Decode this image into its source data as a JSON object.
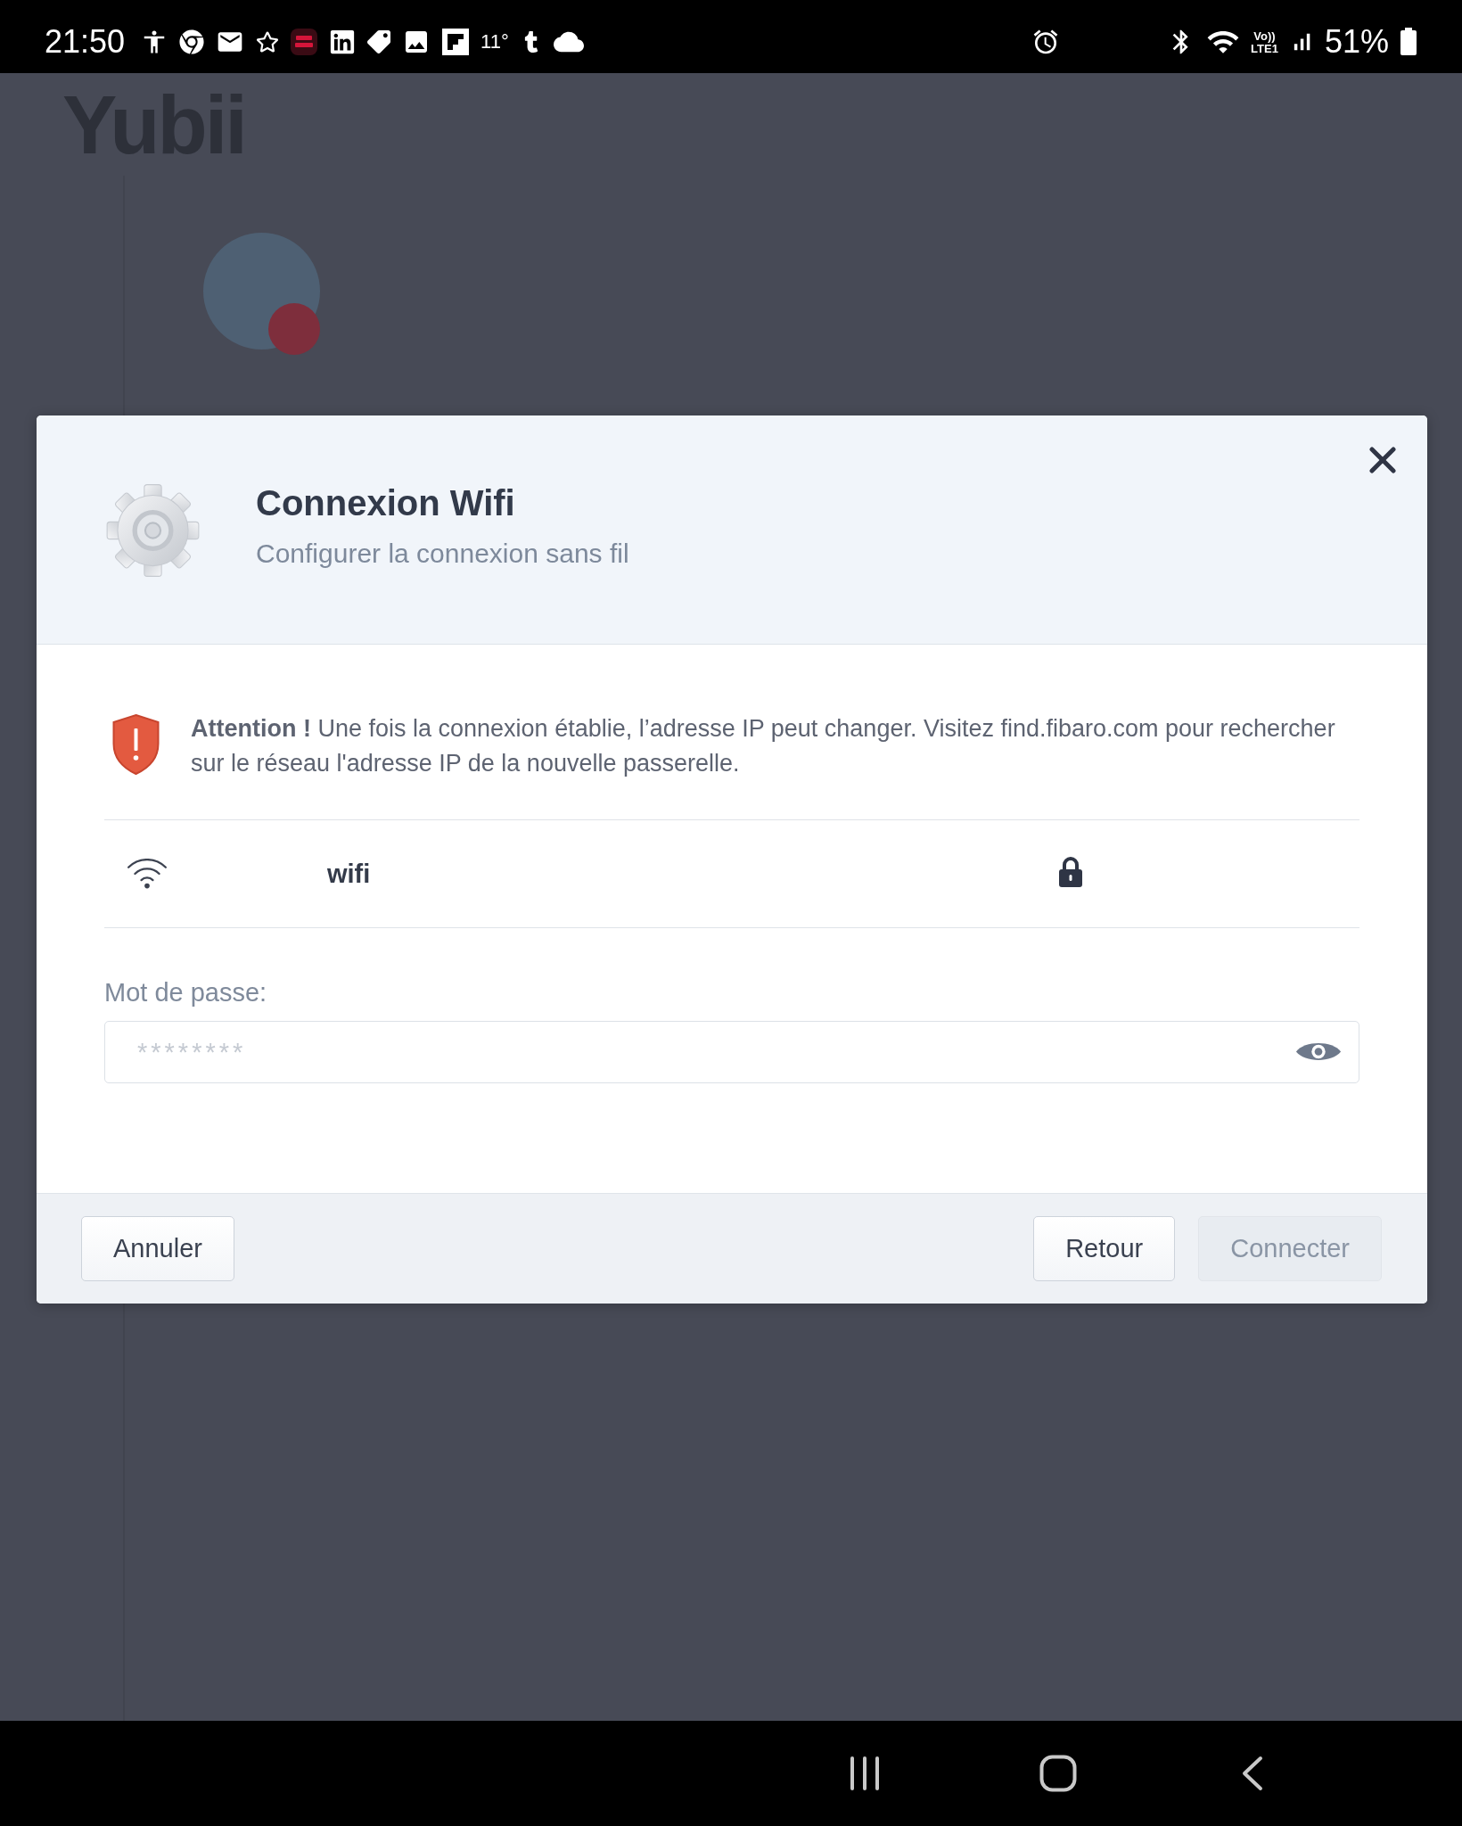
{
  "status_bar": {
    "time": "21:50",
    "temperature": "11°",
    "volte": {
      "top": "Vo))",
      "bottom": "LTE1"
    },
    "battery": "51%"
  },
  "background": {
    "logo": "Yubii"
  },
  "dialog": {
    "title": "Connexion Wifi",
    "subtitle": "Configurer la connexion sans fil",
    "alert": "**Attention !** Une fois la connexion établie, l’adresse IP peut changer. Visitez find.fibaro.com pour rechercher sur le réseau l'adresse IP de la nouvelle passerelle.",
    "network": {
      "name": "wifi",
      "secured": true
    },
    "password": {
      "label": "Mot de passe:",
      "placeholder": "********"
    },
    "footer": {
      "left_buttons": [
        {
          "label": "Annuler",
          "disabled": false
        }
      ],
      "right_buttons": [
        {
          "label": "Retour",
          "disabled": false
        },
        {
          "label": "Connecter",
          "disabled": true
        }
      ]
    }
  }
}
